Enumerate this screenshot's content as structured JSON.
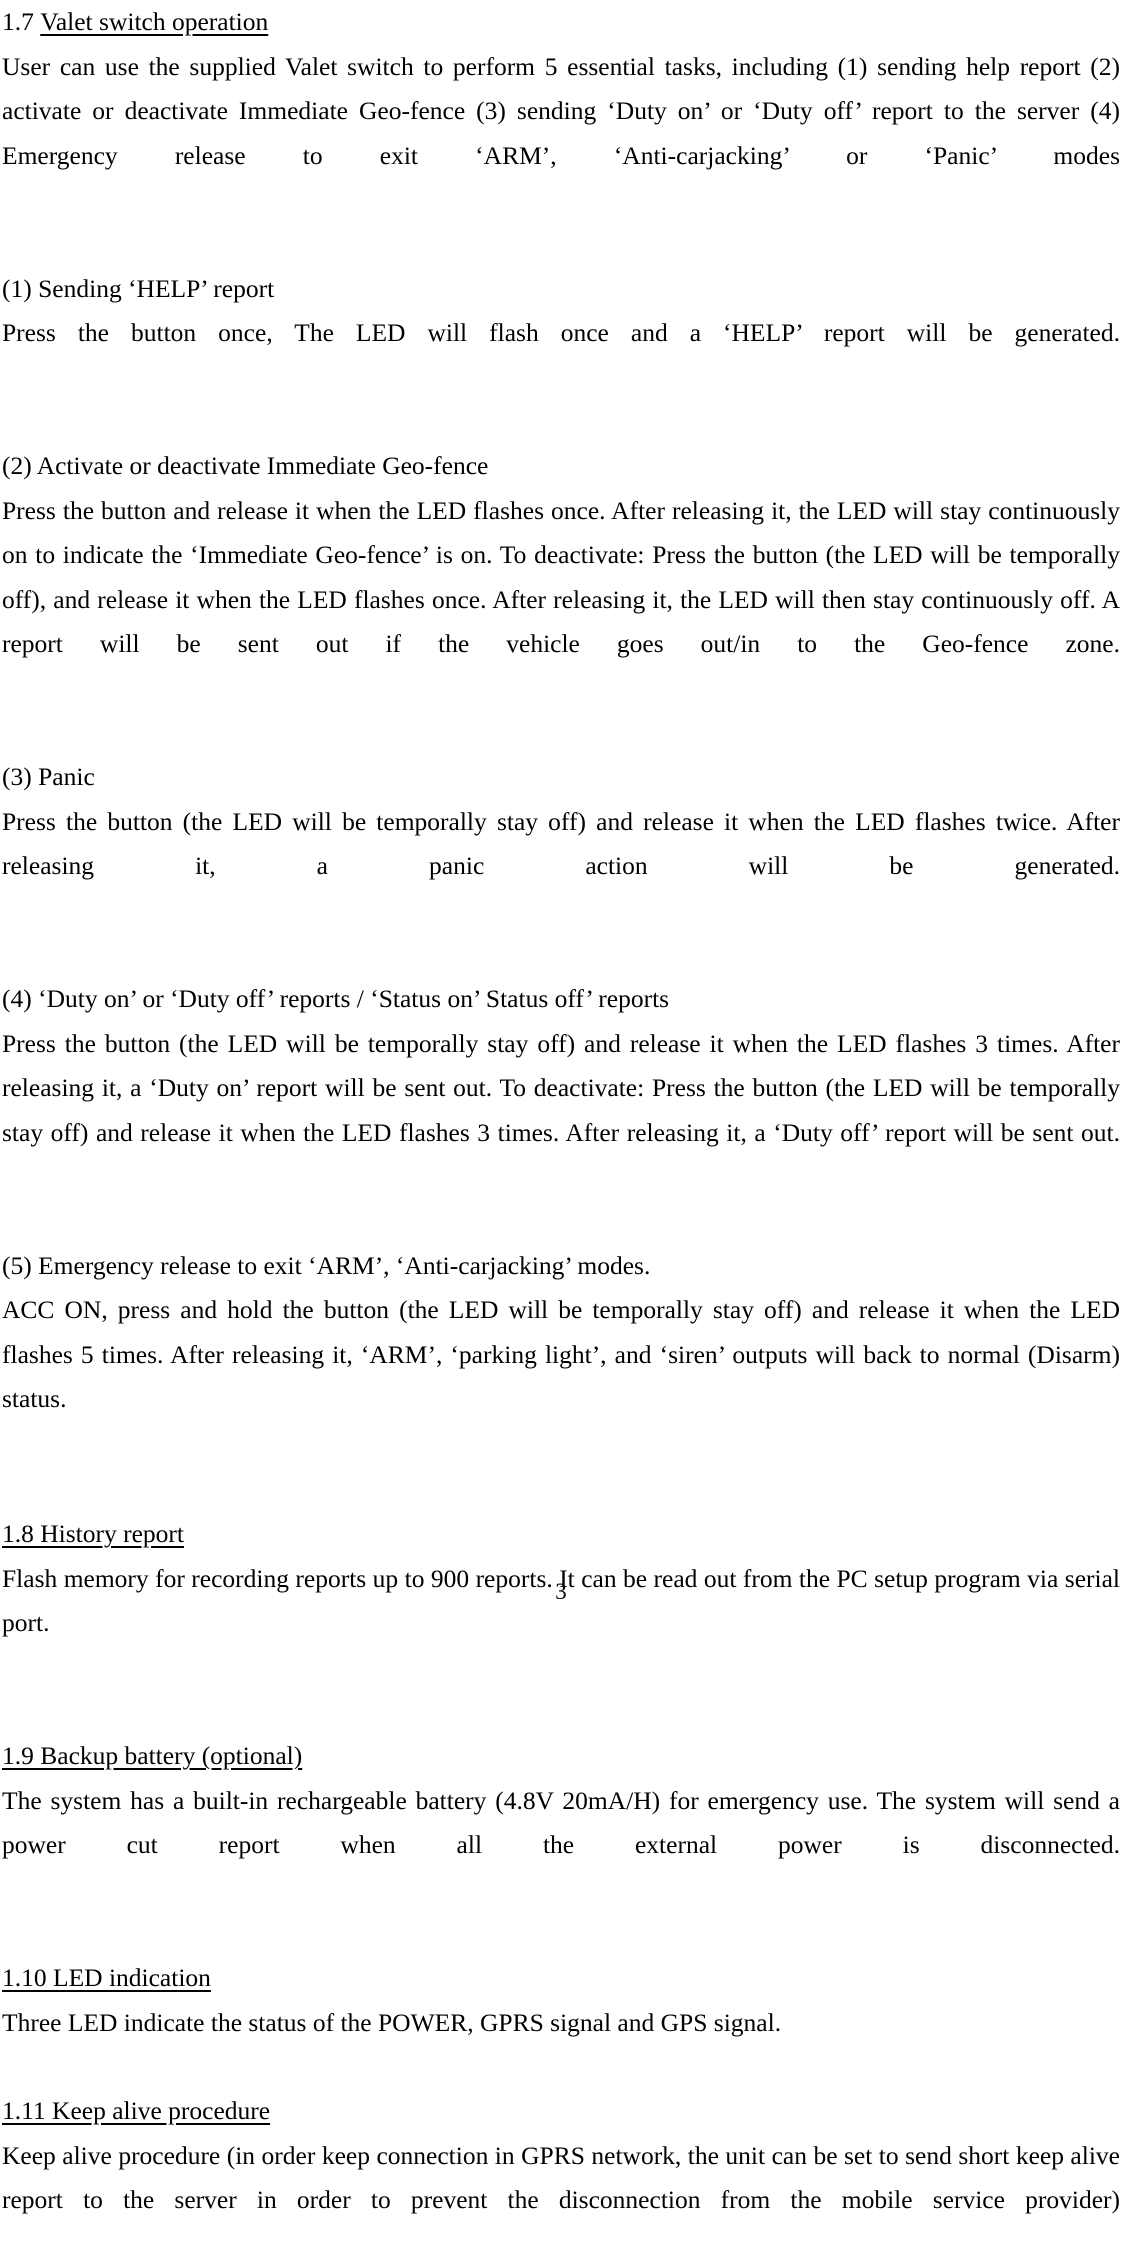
{
  "document": {
    "page_number": "3",
    "sections": [
      {
        "id": "sec-1-7",
        "number": "1.7",
        "heading_underlined": "Valet switch operation ",
        "heading_number_underlined": false,
        "paragraphs": [
          "User can use the supplied Valet switch to perform 5 essential tasks, including (1) sending help report (2) activate or deactivate Immediate Geo-fence (3) sending ‘Duty on’ or ‘Duty off’ report to the server (4) Emergency release to exit ‘ARM’, ‘Anti-carjacking’ or ‘Panic’ modes"
        ]
      },
      {
        "id": "item-1",
        "title": "(1) Sending ‘HELP’ report",
        "body": "Press the button once, The LED will flash once and a ‘HELP’ report will be generated."
      },
      {
        "id": "item-2",
        "title": "(2) Activate or deactivate Immediate Geo-fence",
        "body": "Press the button and release it when the LED flashes once. After releasing it, the LED will stay continuously on to indicate the ‘Immediate Geo-fence’ is on. To deactivate: Press the button (the LED will be temporally off), and release it when the LED flashes once. After releasing it, the LED will then stay continuously off. A report will be sent out if the vehicle goes out/in to the Geo-fence zone."
      },
      {
        "id": "item-3",
        "title": "(3) Panic",
        "body": "Press the button (the LED will be temporally stay off) and release it when the LED flashes twice. After releasing it, a panic action will be generated."
      },
      {
        "id": "item-4",
        "title": "(4) ‘Duty on’ or ‘Duty off’ reports / ‘Status on’ Status off’ reports",
        "body": "Press the button (the LED will be temporally stay off) and release it when the LED flashes 3 times. After releasing it, a ‘Duty on’ report will be sent out. To deactivate: Press the button (the LED will be temporally stay off) and release it when the LED flashes 3 times. After releasing it, a ‘Duty off’ report will be sent out."
      },
      {
        "id": "item-5",
        "title": "(5) Emergency release to exit ‘ARM’, ‘Anti-carjacking’ modes.",
        "body": "ACC ON, press and hold the button (the LED will be temporally stay off) and release it when the LED flashes 5 times. After releasing it, ‘ARM’, ‘parking light’, and ‘siren’ outputs will back to normal (Disarm) status."
      },
      {
        "id": "sec-1-8",
        "number": "1.8",
        "heading_underlined": "1.8 History report",
        "heading_number_underlined": true,
        "paragraphs": [
          "Flash memory for recording reports up to 900 reports. It can be read out from the PC setup program via serial port."
        ]
      },
      {
        "id": "sec-1-9",
        "number": "1.9",
        "heading_underlined": "1.9 Backup battery (optional)",
        "heading_number_underlined": true,
        "paragraphs": [
          "The system has a built-in rechargeable battery (4.8V 20mA/H) for emergency use. The system will send a power cut report when all the external power is disconnected."
        ]
      },
      {
        "id": "sec-1-10",
        "number": "1.10",
        "heading_underlined": "1.10 LED indication",
        "heading_number_underlined": true,
        "paragraphs": [
          "Three LED indicate the status of the POWER, GPRS signal and GPS signal."
        ]
      },
      {
        "id": "sec-1-11",
        "number": "1.11",
        "heading_underlined": "1.11 Keep alive procedure",
        "heading_number_underlined": true,
        "paragraphs": [
          "Keep alive procedure (in order keep connection in GPRS network, the unit can be set to send short keep alive report to the server in order to prevent the disconnection from the mobile service provider)"
        ]
      }
    ]
  }
}
